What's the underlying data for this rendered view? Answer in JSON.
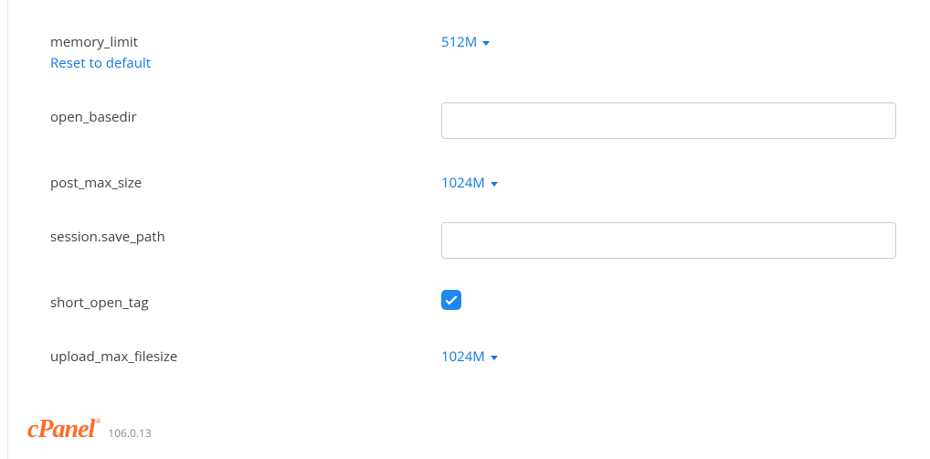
{
  "settings": [
    {
      "name": "memory_limit",
      "type": "dropdown",
      "value": "512M",
      "reset_label": "Reset to default"
    },
    {
      "name": "open_basedir",
      "type": "text",
      "value": ""
    },
    {
      "name": "post_max_size",
      "type": "dropdown",
      "value": "1024M"
    },
    {
      "name": "session.save_path",
      "type": "text",
      "value": ""
    },
    {
      "name": "short_open_tag",
      "type": "checkbox",
      "checked": true
    },
    {
      "name": "upload_max_filesize",
      "type": "dropdown",
      "value": "1024M"
    }
  ],
  "footer": {
    "brand": "cPanel",
    "version": "106.0.13"
  }
}
